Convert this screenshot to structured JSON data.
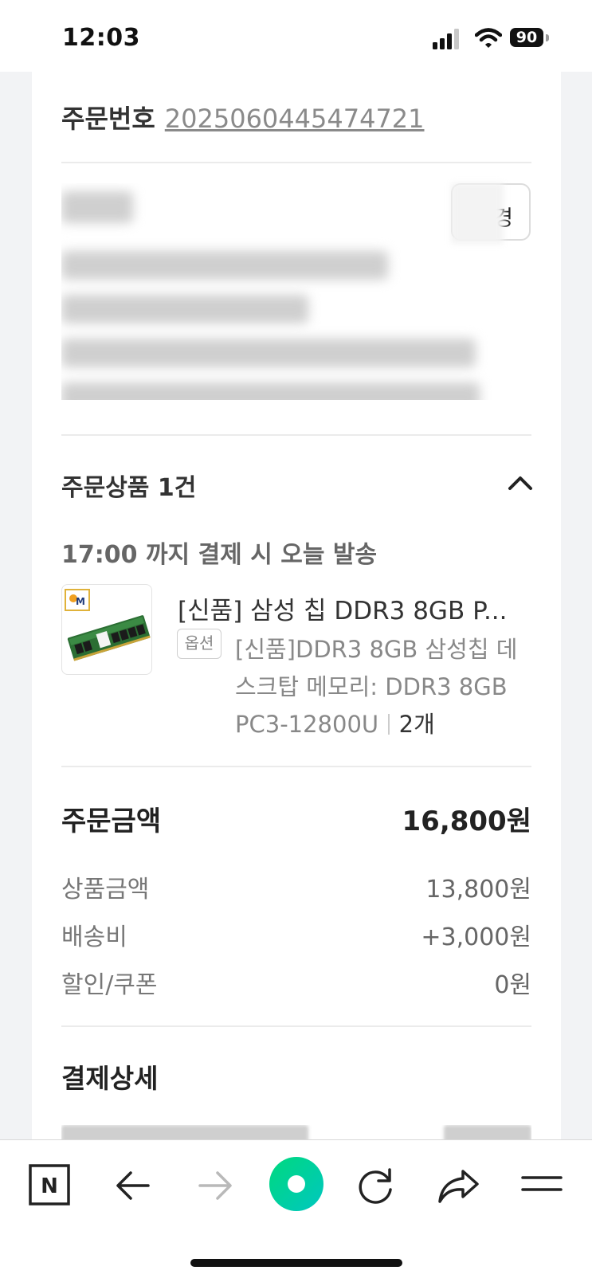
{
  "status_bar": {
    "time": "12:03",
    "battery": "90"
  },
  "order": {
    "label": "주문번호",
    "number": "2025060445474721"
  },
  "address": {
    "change_button_label": "경"
  },
  "items": {
    "title": "주문상품 1건",
    "shipping_note": "17:00 까지 결제 시 오늘 발송",
    "product": {
      "name": "[신품] 삼성 칩 DDR3 8GB P...",
      "option_badge": "옵션",
      "option_text": "[신품]DDR3 8GB 삼성칩 데스크탑 메모리: DDR3 8GB PC3-12800U",
      "quantity": "2개"
    }
  },
  "summary": {
    "total_label": "주문금액",
    "total_value": "16,800원",
    "rows": [
      {
        "label": "상품금액",
        "value": "13,800원"
      },
      {
        "label": "배송비",
        "value": "+3,000원"
      },
      {
        "label": "할인/쿠폰",
        "value": "0원"
      }
    ]
  },
  "payment": {
    "title": "결제상세"
  },
  "toolbar": {
    "n_label": "N"
  },
  "colors": {
    "accent_green": "#03c75a",
    "background": "#f2f3f5"
  }
}
